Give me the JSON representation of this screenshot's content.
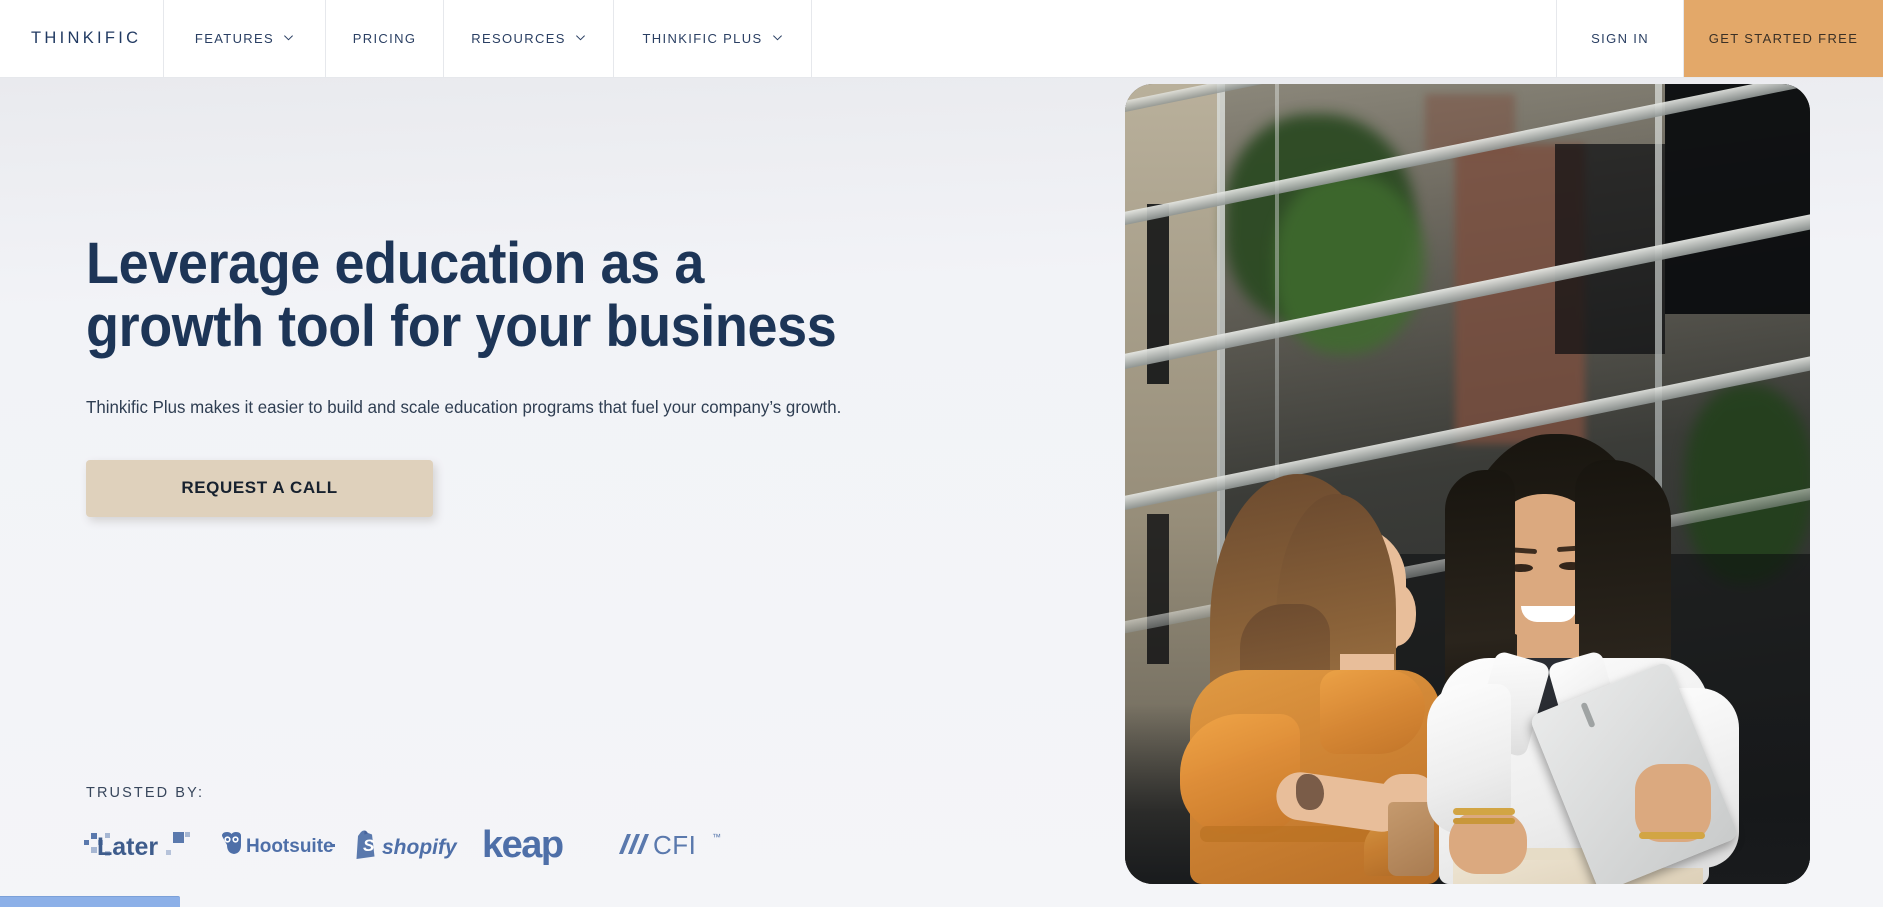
{
  "nav": {
    "brand": "THINKIFIC",
    "items": [
      {
        "label": "FEATURES",
        "has_chevron": true,
        "icon": "chevron-down-icon"
      },
      {
        "label": "PRICING",
        "has_chevron": false,
        "icon": ""
      },
      {
        "label": "RESOURCES",
        "has_chevron": true,
        "icon": "chevron-down-icon"
      },
      {
        "label": "THINKIFIC PLUS",
        "has_chevron": true,
        "icon": "chevron-down-icon"
      }
    ],
    "sign_in": "SIGN IN",
    "cta": "GET STARTED FREE",
    "cta_color": "#E3A869"
  },
  "hero": {
    "title": "Leverage education as a growth tool for your business",
    "subtitle": "Thinkific Plus makes it easier to build and scale education programs that fuel your company’s growth.",
    "cta_label": "REQUEST A CALL",
    "cta_bg": "#DFD1BC",
    "title_color": "#1D3557",
    "background": "#F4F5F8"
  },
  "trusted": {
    "label": "TRUSTED BY:",
    "logos": [
      {
        "name": "Later",
        "icon": "later-logo"
      },
      {
        "name": "Hootsuite",
        "icon": "hootsuite-logo"
      },
      {
        "name": "shopify",
        "icon": "shopify-logo"
      },
      {
        "name": "keap",
        "icon": "keap-logo"
      },
      {
        "name": "CFI",
        "icon": "cfi-logo",
        "trademark": "™"
      }
    ],
    "logo_color": "#5A79AD"
  },
  "photo": {
    "alt": "Two women outside an office building looking at a tablet"
  },
  "scroll": {
    "progress_color": "#8CB0E8"
  }
}
